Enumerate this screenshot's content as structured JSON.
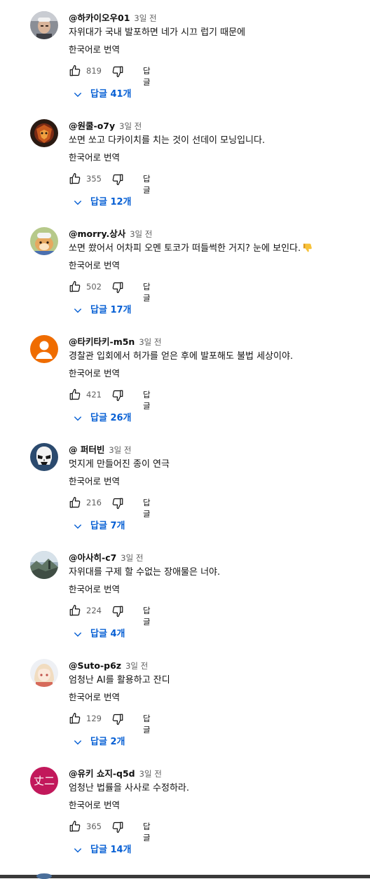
{
  "ui": {
    "translate_label": "한국어로 번역",
    "reply_label": "답글"
  },
  "colors": {
    "accent_link": "#065fd4",
    "secondary_text": "#606060"
  },
  "comments": [
    {
      "author": "@하카이오우01",
      "time": "3일 전",
      "text": "자위대가 국내 발포하면 네가 시끄 럽기 때문에",
      "likes": "819",
      "replies_label": "답글 41개",
      "avatar_icon": "man-photo-avatar-icon"
    },
    {
      "author": "@원쿨-o7y",
      "time": "3일 전",
      "text": "쏘면 쏘고 다카이치를 치는 것이 선데이 모닝입니다.",
      "likes": "355",
      "replies_label": "답글 12개",
      "avatar_icon": "character-avatar-icon"
    },
    {
      "author": "@morry.상사",
      "time": "3일 전",
      "text": "쏘면 쐈어서 어차피 오멘 토코가 떠들썩한 거지? 눈에 보인다.",
      "likes": "502",
      "replies_label": "답글 17개",
      "avatar_icon": "cartoon-dog-avatar-icon",
      "emoji_icon": "thumbs-down-emoji-icon"
    },
    {
      "author": "@타키타키-m5n",
      "time": "3일 전",
      "text": "경찰관 입회에서 허가를 얻은 후에 발포해도 불법 세상이야.",
      "likes": "421",
      "replies_label": "답글 26개",
      "avatar_icon": "default-person-avatar-icon"
    },
    {
      "author": "@ 퍼터빈",
      "time": "3일 전",
      "text": "멋지게 만들어진 종이 연극",
      "likes": "216",
      "replies_label": "답글 7개",
      "avatar_icon": "stormtrooper-avatar-icon"
    },
    {
      "author": "@아사히-c7",
      "time": "3일 전",
      "text": "자위대를 구제 할 수없는 장애물은 너야.",
      "likes": "224",
      "replies_label": "답글 4개",
      "avatar_icon": "landscape-photo-avatar-icon"
    },
    {
      "author": "@Suto-p6z",
      "time": "3일 전",
      "text": "엄청난 AI를 활용하고 잔디",
      "likes": "129",
      "replies_label": "답글 2개",
      "avatar_icon": "anime-girl-avatar-icon"
    },
    {
      "author": "@유키 쇼지-q5d",
      "time": "3일 전",
      "text": "엄청난 법률을 사사로 수정하라.",
      "likes": "365",
      "replies_label": "답글 14개",
      "avatar_icon": "kanji-avatar-icon",
      "avatar_text": "丈二"
    }
  ]
}
